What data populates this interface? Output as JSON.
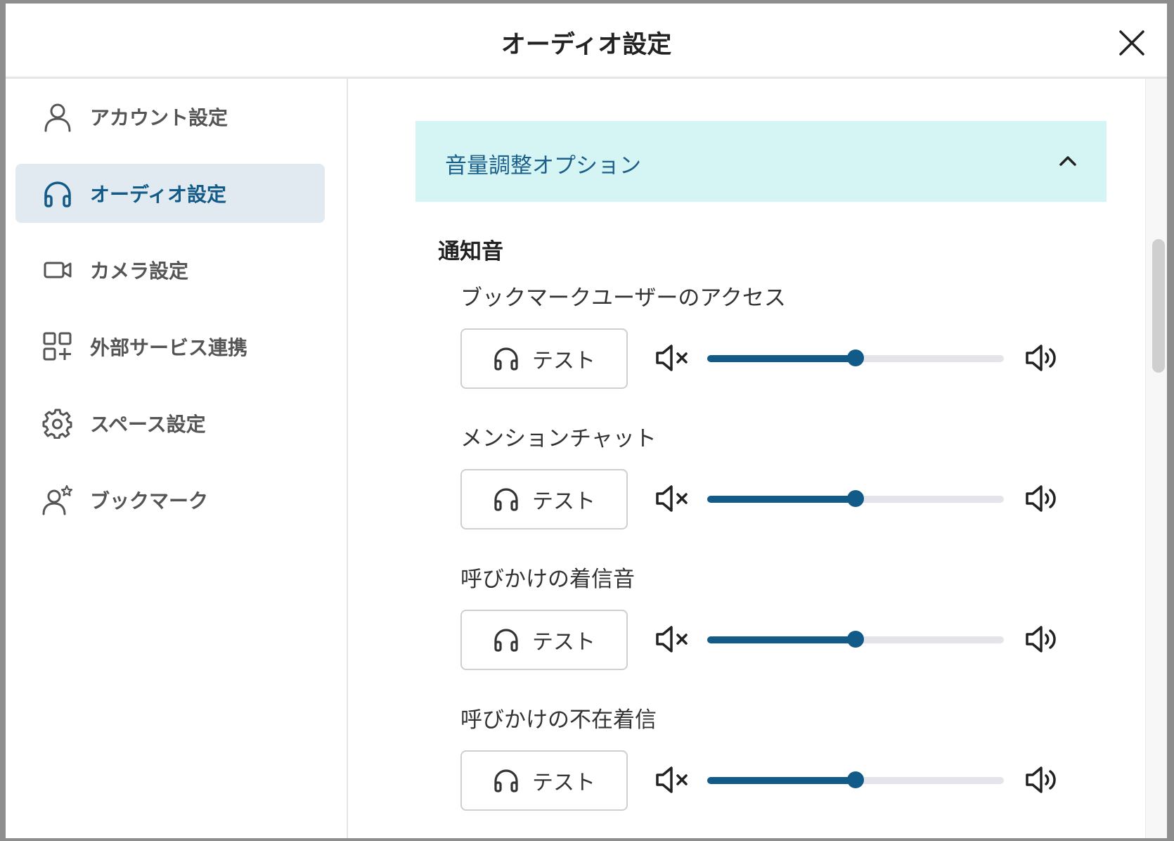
{
  "dialog": {
    "title": "オーディオ設定"
  },
  "sidebar": {
    "items": [
      {
        "label": "アカウント設定",
        "icon": "user-icon",
        "active": false
      },
      {
        "label": "オーディオ設定",
        "icon": "headphones-icon",
        "active": true
      },
      {
        "label": "カメラ設定",
        "icon": "video-camera-icon",
        "active": false
      },
      {
        "label": "外部サービス連携",
        "icon": "apps-add-icon",
        "active": false
      },
      {
        "label": "スペース設定",
        "icon": "gear-icon",
        "active": false
      },
      {
        "label": "ブックマーク",
        "icon": "user-star-icon",
        "active": false
      }
    ]
  },
  "accordion": {
    "title": "音量調整オプション",
    "expanded": true
  },
  "section": {
    "title": "通知音"
  },
  "sounds": [
    {
      "label": "ブックマークユーザーのアクセス",
      "test_label": "テスト",
      "volume_percent": 50
    },
    {
      "label": "メンションチャット",
      "test_label": "テスト",
      "volume_percent": 50
    },
    {
      "label": "呼びかけの着信音",
      "test_label": "テスト",
      "volume_percent": 50
    },
    {
      "label": "呼びかけの不在着信",
      "test_label": "テスト",
      "volume_percent": 50
    }
  ],
  "colors": {
    "accent": "#125a87",
    "active_bg": "#e2eaf1",
    "accordion_bg": "#d5f5f4"
  }
}
